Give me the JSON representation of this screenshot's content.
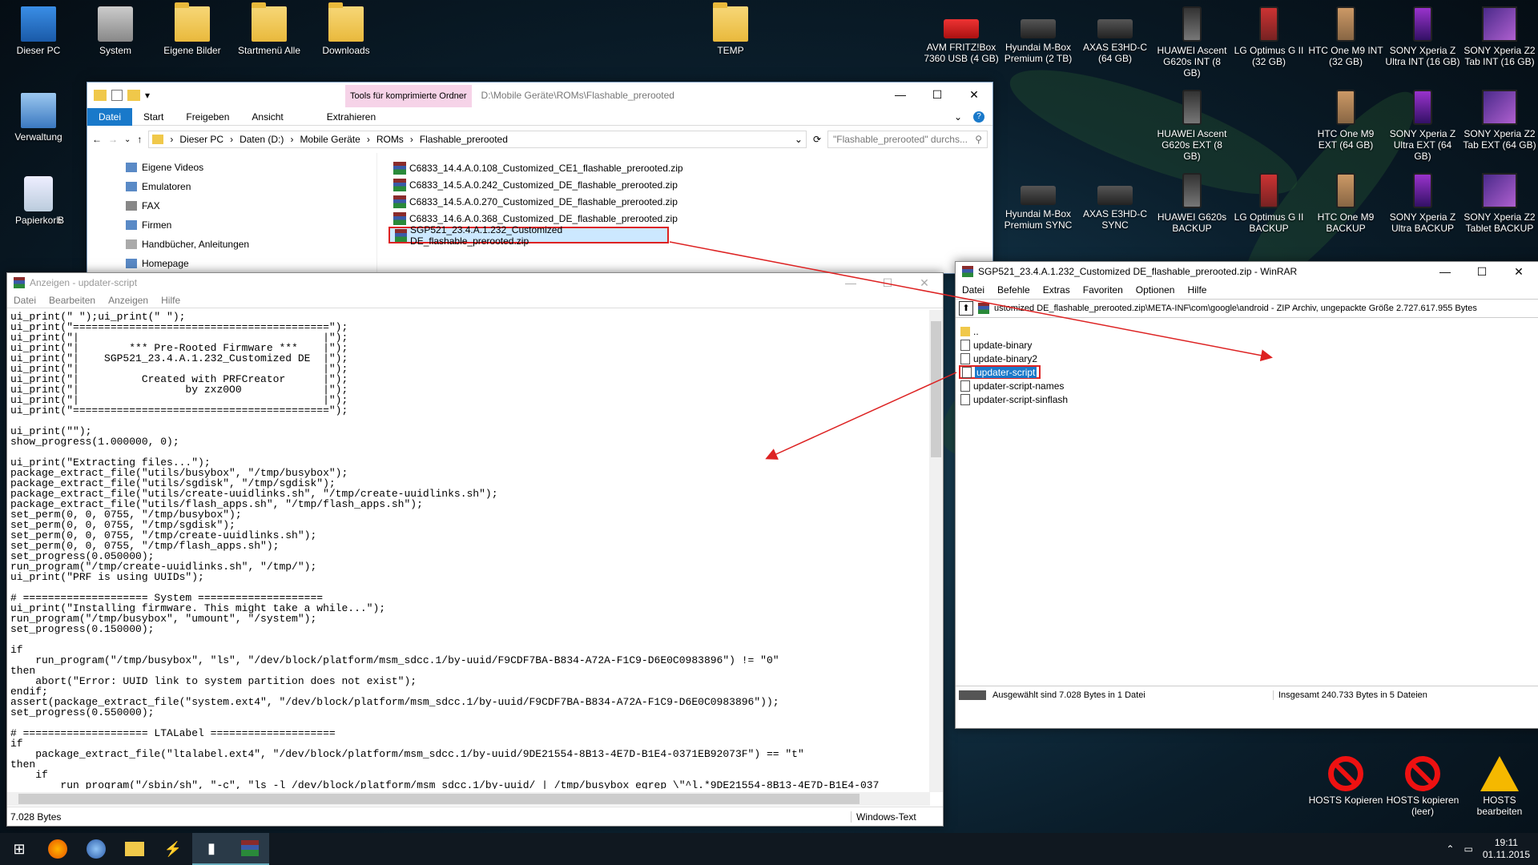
{
  "desktop": {
    "icons": [
      {
        "label": "Dieser PC",
        "type": "pc"
      },
      {
        "label": "System",
        "type": "disk"
      },
      {
        "label": "Eigene Bilder",
        "type": "folder"
      },
      {
        "label": "Startmenü Alle",
        "type": "folder"
      },
      {
        "label": "Downloads",
        "type": "folder"
      },
      {
        "label": "TEMP",
        "type": "folder"
      },
      {
        "label": "Verwaltung",
        "type": "tool"
      },
      {
        "label": "Papierkorb",
        "type": "bin"
      },
      {
        "label": "B",
        "type": "folder"
      }
    ],
    "devices_row1": [
      {
        "label": "AVM FRITZ!Box 7360 USB (4 GB)",
        "type": "router"
      },
      {
        "label": "Hyundai M-Box Premium (2 TB)",
        "type": "box"
      },
      {
        "label": "AXAS E3HD-C (64 GB)",
        "type": "box"
      },
      {
        "label": "HUAWEI Ascent G620s INT (8 GB)",
        "type": "phone"
      },
      {
        "label": "LG Optimus G II (32 GB)",
        "type": "phone"
      },
      {
        "label": "HTC One M9 INT (32 GB)",
        "type": "phone"
      },
      {
        "label": "SONY Xperia Z Ultra INT (16 GB)",
        "type": "phone"
      },
      {
        "label": "SONY Xperia Z2 Tab INT (16 GB)",
        "type": "tablet"
      }
    ],
    "devices_row2": [
      {
        "label": "HUAWEI Ascent G620s EXT (8 GB)",
        "type": "phone"
      },
      {
        "label": "HTC One M9 EXT (64 GB)",
        "type": "phone"
      },
      {
        "label": "SONY Xperia Z Ultra EXT (64 GB)",
        "type": "phone"
      },
      {
        "label": "SONY Xperia Z2 Tab EXT (64 GB)",
        "type": "tablet"
      }
    ],
    "devices_row3": [
      {
        "label": "Hyundai M-Box Premium SYNC",
        "type": "box"
      },
      {
        "label": "AXAS E3HD-C SYNC",
        "type": "box"
      },
      {
        "label": "HUAWEI G620s BACKUP",
        "type": "phone"
      },
      {
        "label": "LG Optimus G II BACKUP",
        "type": "phone"
      },
      {
        "label": "HTC One M9 BACKUP",
        "type": "phone"
      },
      {
        "label": "SONY Xperia Z Ultra BACKUP",
        "type": "phone"
      },
      {
        "label": "SONY Xperia Z2 Tablet BACKUP",
        "type": "tablet"
      }
    ],
    "hosts": [
      {
        "label": "HOSTS Kopieren",
        "type": "redx"
      },
      {
        "label": "HOSTS kopieren (leer)",
        "type": "redx"
      },
      {
        "label": "HOSTS bearbeiten",
        "type": "warning"
      }
    ]
  },
  "explorer": {
    "context_tab": "Tools für komprimierte Ordner",
    "title": "D:\\Mobile Geräte\\ROMs\\Flashable_prerooted",
    "tabs": [
      "Datei",
      "Start",
      "Freigeben",
      "Ansicht",
      "Extrahieren"
    ],
    "breadcrumb": [
      "Dieser PC",
      "Daten (D:)",
      "Mobile Geräte",
      "ROMs",
      "Flashable_prerooted"
    ],
    "search_placeholder": "\"Flashable_prerooted\" durchs...",
    "nav_items": [
      "Eigene Videos",
      "Emulatoren",
      "FAX",
      "Firmen",
      "Handbücher, Anleitungen",
      "Homepage"
    ],
    "files": [
      "C6833_14.4.A.0.108_Customized_CE1_flashable_prerooted.zip",
      "C6833_14.5.A.0.242_Customized_DE_flashable_prerooted.zip",
      "C6833_14.5.A.0.270_Customized_DE_flashable_prerooted.zip",
      "C6833_14.6.A.0.368_Customized_DE_flashable_prerooted.zip",
      "SGP521_23.4.A.1.232_Customized DE_flashable_prerooted.zip"
    ],
    "selected_index": 4
  },
  "notepad": {
    "title": "Anzeigen - updater-script",
    "menu": [
      "Datei",
      "Bearbeiten",
      "Anzeigen",
      "Hilfe"
    ],
    "lines": [
      "ui_print(\" \");ui_print(\" \");",
      "ui_print(\"=========================================\");",
      "ui_print(\"|                                       |\");",
      "ui_print(\"|        *** Pre-Rooted Firmware ***    |\");",
      "ui_print(\"|    SGP521_23.4.A.1.232_Customized DE  |\");",
      "ui_print(\"|                                       |\");",
      "ui_print(\"|          Created with PRFCreator      |\");",
      "ui_print(\"|                 by zxz0O0             |\");",
      "ui_print(\"|                                       |\");",
      "ui_print(\"=========================================\");",
      "",
      "ui_print(\"\");",
      "show_progress(1.000000, 0);",
      "",
      "ui_print(\"Extracting files...\");",
      "package_extract_file(\"utils/busybox\", \"/tmp/busybox\");",
      "package_extract_file(\"utils/sgdisk\", \"/tmp/sgdisk\");",
      "package_extract_file(\"utils/create-uuidlinks.sh\", \"/tmp/create-uuidlinks.sh\");",
      "package_extract_file(\"utils/flash_apps.sh\", \"/tmp/flash_apps.sh\");",
      "set_perm(0, 0, 0755, \"/tmp/busybox\");",
      "set_perm(0, 0, 0755, \"/tmp/sgdisk\");",
      "set_perm(0, 0, 0755, \"/tmp/create-uuidlinks.sh\");",
      "set_perm(0, 0, 0755, \"/tmp/flash_apps.sh\");",
      "set_progress(0.050000);",
      "run_program(\"/tmp/create-uuidlinks.sh\", \"/tmp/\");",
      "ui_print(\"PRF is using UUIDs\");",
      "",
      "# ==================== System ====================",
      "ui_print(\"Installing firmware. This might take a while...\");",
      "run_program(\"/tmp/busybox\", \"umount\", \"/system\");",
      "set_progress(0.150000);",
      "",
      "if",
      "    run_program(\"/tmp/busybox\", \"ls\", \"/dev/block/platform/msm_sdcc.1/by-uuid/F9CDF7BA-B834-A72A-F1C9-D6E0C0983896\") != \"0\"",
      "then",
      "    abort(\"Error: UUID link to system partition does not exist\");",
      "endif;",
      "assert(package_extract_file(\"system.ext4\", \"/dev/block/platform/msm_sdcc.1/by-uuid/F9CDF7BA-B834-A72A-F1C9-D6E0C0983896\"));",
      "set_progress(0.550000);",
      "",
      "# ==================== LTALabel ====================",
      "if",
      "    package_extract_file(\"ltalabel.ext4\", \"/dev/block/platform/msm_sdcc.1/by-uuid/9DE21554-8B13-4E7D-B1E4-0371EB92073F\") == \"t\"",
      "then",
      "    if",
      "        run_program(\"/sbin/sh\", \"-c\", \"ls -l /dev/block/platform/msm_sdcc.1/by-uuid/ | /tmp/busybox egrep \\\"^l.*9DE21554-8B13-4E7D-B1E4-037"
    ],
    "status_left": "7.028 Bytes",
    "status_right": "Windows-Text"
  },
  "winrar": {
    "title": "SGP521_23.4.A.1.232_Customized DE_flashable_prerooted.zip - WinRAR",
    "menu": [
      "Datei",
      "Befehle",
      "Extras",
      "Favoriten",
      "Optionen",
      "Hilfe"
    ],
    "path": "ustomized DE_flashable_prerooted.zip\\META-INF\\com\\google\\android - ZIP Archiv, ungepackte Größe 2.727.617.955 Bytes",
    "items": [
      "..",
      "update-binary",
      "update-binary2",
      "updater-script",
      "updater-script-names",
      "updater-script-sinflash"
    ],
    "selected_index": 3,
    "status_left": "Ausgewählt sind 7.028 Bytes in 1 Datei",
    "status_right": "Insgesamt 240.733 Bytes in 5 Dateien"
  },
  "taskbar": {
    "time": "19:11",
    "date": "01.11.2015",
    "apps": [
      "start-icon",
      "firefox-icon",
      "thunderbird-icon",
      "explorer-icon",
      "tool-icon",
      "video-icon",
      "winrar-icon"
    ]
  }
}
